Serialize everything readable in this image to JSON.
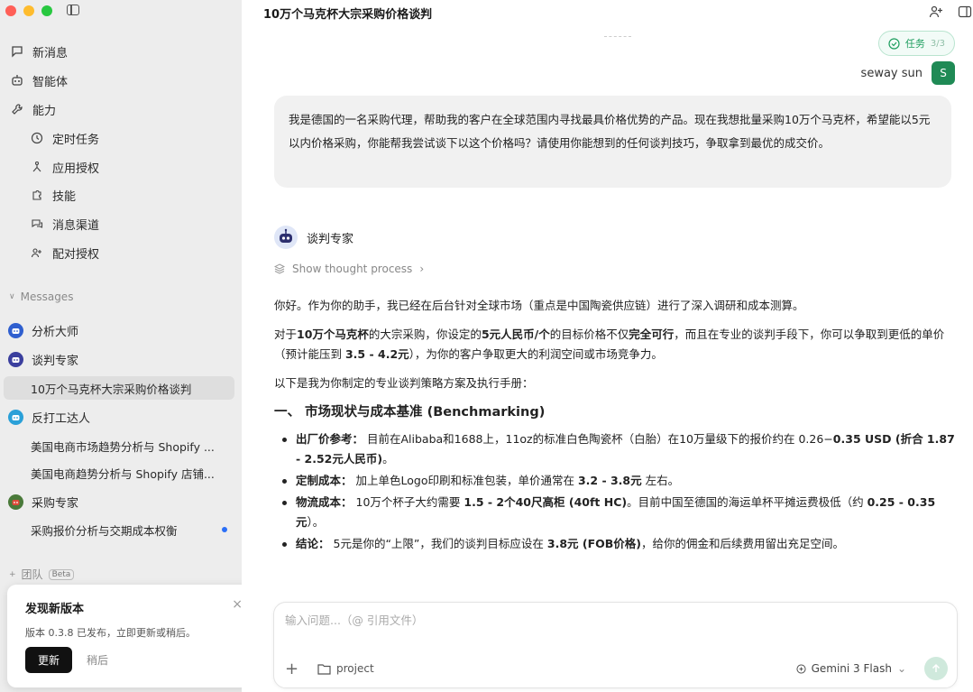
{
  "sidebar": {
    "nav": [
      {
        "label": "新消息",
        "icon": "message-icon"
      },
      {
        "label": "智能体",
        "icon": "robot-icon"
      },
      {
        "label": "能力",
        "icon": "wrench-icon"
      }
    ],
    "capabilities": [
      {
        "label": "定时任务",
        "icon": "clock-icon"
      },
      {
        "label": "应用授权",
        "icon": "network-icon"
      },
      {
        "label": "技能",
        "icon": "puzzle-icon"
      },
      {
        "label": "消息渠道",
        "icon": "chat-channel-icon"
      },
      {
        "label": "配对授权",
        "icon": "user-pair-icon"
      }
    ],
    "messages_label": "Messages",
    "conversations": [
      {
        "label": "分析大师",
        "type": "agent",
        "color": "#2f5fcf"
      },
      {
        "label": "谈判专家",
        "type": "agent",
        "color": "#3b3f9e"
      },
      {
        "label": "10万个马克杯大宗采购价格谈判",
        "type": "child",
        "selected": true
      },
      {
        "label": "反打工达人",
        "type": "agent",
        "color": "#2aa0d8"
      },
      {
        "label": "美国电商市场趋势分析与 Shopify ...",
        "type": "child"
      },
      {
        "label": "美国电商趋势分析与 Shopify 店铺...",
        "type": "child"
      },
      {
        "label": "采购专家",
        "type": "agent",
        "color": "#4a7a3a"
      },
      {
        "label": "采购报价分析与交期成本权衡",
        "type": "child",
        "unread": true
      }
    ],
    "team_label": "团队",
    "beta_label": "Beta"
  },
  "toast": {
    "title": "发现新版本",
    "desc": "版本 0.3.8 已发布，立即更新或稍后。",
    "update": "更新",
    "later": "稍后",
    "close": "×"
  },
  "header": {
    "title": "10万个马克杯大宗采购价格谈判",
    "task_label": "任务",
    "task_count": "3/3"
  },
  "user": {
    "name": "seway sun",
    "initial": "S",
    "message": "我是德国的一名采购代理，帮助我的客户在全球范围内寻找最具价格优势的产品。现在我想批量采购10万个马克杯，希望能以5元以内价格采购，你能帮我尝试谈下以这个价格吗？请使用你能想到的任何谈判技巧，争取拿到最优的成交价。"
  },
  "assistant": {
    "name": "谈判专家",
    "thought_label": "Show thought process",
    "p1": "你好。作为你的助手，我已经在后台针对全球市场（重点是中国陶瓷供应链）进行了深入调研和成本测算。",
    "p2_a": "对于",
    "p2_b": "10万个马克杯",
    "p2_c": "的大宗采购，你设定的",
    "p2_d": "5元人民币/个",
    "p2_e": "的目标价格不仅",
    "p2_f": "完全可行",
    "p2_g": "，而且在专业的谈判手段下，你可以争取到更低的单价（预计能压到 ",
    "p2_h": "3.5 - 4.2元",
    "p2_i": "），为你的客户争取更大的利润空间或市场竞争力。",
    "p3": "以下是我为你制定的专业谈判策略方案及执行手册：",
    "h1": "一、 市场现状与成本基准 (Benchmarking)",
    "b1_label": "出厂价参考：",
    "b1_text": " 目前在Alibaba和1688上，11oz的标准白色陶瓷杯（白胎）在10万量级下的报价约在 0.26−",
    "b1_bold": "0.35 USD (折合 1.87 - 2.52元人民币)",
    "b1_end": "。",
    "b2_label": "定制成本：",
    "b2_text": " 加上单色Logo印刷和标准包装，单价通常在 ",
    "b2_bold": "3.2 - 3.8元",
    "b2_end": " 左右。",
    "b3_label": "物流成本：",
    "b3_text": " 10万个杯子大约需要 ",
    "b3_bold": "1.5 - 2个40尺高柜 (40ft HC)",
    "b3_text2": "。目前中国至德国的海运单杯平摊运费极低（约 ",
    "b3_bold2": "0.25 - 0.35元",
    "b3_end": "）。",
    "b4_label": "结论：",
    "b4_text": " 5元是你的“上限”，我们的谈判目标应设在 ",
    "b4_bold": "3.8元 (FOB价格)",
    "b4_end": "，给你的佣金和后续费用留出充足空间。"
  },
  "composer": {
    "placeholder": "输入问题...（@ 引用文件）",
    "plus": "+",
    "project": "project",
    "model": "Gemini 3 Flash"
  }
}
